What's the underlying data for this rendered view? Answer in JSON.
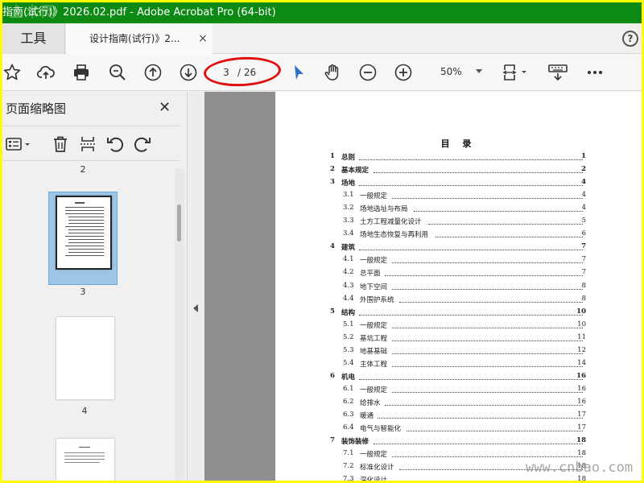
{
  "window": {
    "title": "指南(试行)》2026.02.pdf - Adobe Acrobat Pro (64-bit)",
    "watermark_top": "土木网"
  },
  "tabs": {
    "tools_label": "工具",
    "doc_label": "设计指南(试行)》2...",
    "close_glyph": "×",
    "help_glyph": "?"
  },
  "toolbar": {
    "page_current": "3",
    "page_total": "/ 26",
    "zoom": "50%",
    "icons": [
      "star-icon",
      "cloud-upload-icon",
      "print-icon",
      "zoom-search-icon",
      "page-up-icon",
      "page-down-icon",
      "select-arrow-icon",
      "hand-icon",
      "zoom-out-icon",
      "zoom-in-icon",
      "page-fit-icon",
      "keyboard-scroll-icon",
      "more-icon"
    ],
    "highlight_color": "#e01010"
  },
  "sidebar": {
    "title": "页面缩略图",
    "close_glyph": "✕",
    "thumbnails": [
      {
        "label": "2"
      },
      {
        "label": "3",
        "selected": true
      },
      {
        "label": "4"
      }
    ]
  },
  "document": {
    "toc_title": "目 录",
    "toc": [
      {
        "num": "1",
        "text": "总则",
        "page": "1",
        "level": 1
      },
      {
        "num": "2",
        "text": "基本规定",
        "page": "2",
        "level": 1
      },
      {
        "num": "3",
        "text": "场地",
        "page": "4",
        "level": 1
      },
      {
        "num": "3.1",
        "text": "一般规定",
        "page": "4",
        "level": 2
      },
      {
        "num": "3.2",
        "text": "场地选址与布局",
        "page": "4",
        "level": 2
      },
      {
        "num": "3.3",
        "text": "土方工程减量化设计",
        "page": "5",
        "level": 2
      },
      {
        "num": "3.4",
        "text": "场地生态恢复与再利用",
        "page": "6",
        "level": 2
      },
      {
        "num": "4",
        "text": "建筑",
        "page": "7",
        "level": 1
      },
      {
        "num": "4.1",
        "text": "一般规定",
        "page": "7",
        "level": 2
      },
      {
        "num": "4.2",
        "text": "总平面",
        "page": "7",
        "level": 2
      },
      {
        "num": "4.3",
        "text": "地下空间",
        "page": "8",
        "level": 2
      },
      {
        "num": "4.4",
        "text": "外围护系统",
        "page": "8",
        "level": 2
      },
      {
        "num": "5",
        "text": "结构",
        "page": "10",
        "level": 1
      },
      {
        "num": "5.1",
        "text": "一般规定",
        "page": "10",
        "level": 2
      },
      {
        "num": "5.2",
        "text": "基坑工程",
        "page": "11",
        "level": 2
      },
      {
        "num": "5.3",
        "text": "地基基础",
        "page": "12",
        "level": 2
      },
      {
        "num": "5.4",
        "text": "主体工程",
        "page": "14",
        "level": 2
      },
      {
        "num": "6",
        "text": "机电",
        "page": "16",
        "level": 1
      },
      {
        "num": "6.1",
        "text": "一般规定",
        "page": "16",
        "level": 2
      },
      {
        "num": "6.2",
        "text": "给排水",
        "page": "16",
        "level": 2
      },
      {
        "num": "6.3",
        "text": "暖通",
        "page": "17",
        "level": 2
      },
      {
        "num": "6.4",
        "text": "电气与智能化",
        "page": "17",
        "level": 2
      },
      {
        "num": "7",
        "text": "装饰装修",
        "page": "18",
        "level": 1
      },
      {
        "num": "7.1",
        "text": "一般规定",
        "page": "18",
        "level": 2
      },
      {
        "num": "7.2",
        "text": "标准化设计",
        "page": "18",
        "level": 2
      },
      {
        "num": "7.3",
        "text": "深化设计",
        "page": "18",
        "level": 2
      }
    ]
  },
  "watermark_bottom": "www.cnbao.com"
}
